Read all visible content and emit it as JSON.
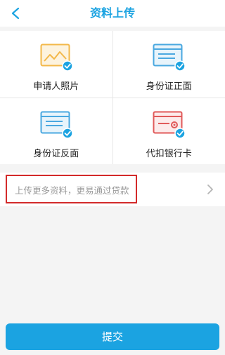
{
  "header": {
    "title": "资料上传",
    "back_icon": "chevron-left-icon"
  },
  "colors": {
    "accent": "#1ba3e1",
    "photo_icon": "#f3b84a",
    "id_icon": "#4aa8e0",
    "card_icon": "#e05a5a",
    "highlight_border": "#d32a2a"
  },
  "upload_items": [
    {
      "label": "申请人照片",
      "icon": "photo-icon",
      "checked": true
    },
    {
      "label": "身份证正面",
      "icon": "id-card-front-icon",
      "checked": true
    },
    {
      "label": "身份证反面",
      "icon": "id-card-back-icon",
      "checked": true
    },
    {
      "label": "代扣银行卡",
      "icon": "bank-card-icon",
      "checked": true
    }
  ],
  "more": {
    "text": "上传更多资料，更易通过贷款",
    "icon": "chevron-right-icon"
  },
  "submit_label": "提交"
}
